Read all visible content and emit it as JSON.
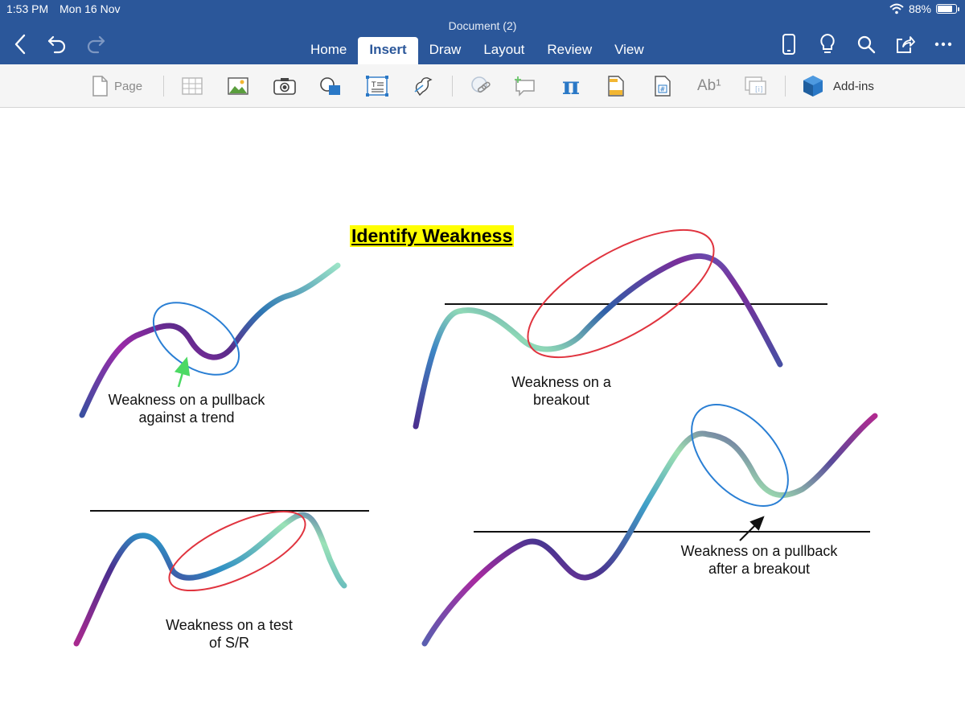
{
  "status_bar": {
    "time": "1:53 PM",
    "date": "Mon 16 Nov",
    "battery": "88%",
    "battery_level": 0.88
  },
  "document_title": "Document (2)",
  "tabs": [
    "Home",
    "Insert",
    "Draw",
    "Layout",
    "Review",
    "View"
  ],
  "active_tab": "Insert",
  "ribbon": {
    "page_label": "Page",
    "addins_label": "Add-ins",
    "pi_symbol": "π",
    "ab_label": "Ab¹"
  },
  "content": {
    "heading": "Identify Weakness",
    "captions": {
      "pullback_trend": [
        "Weakness on a pullback",
        "against a trend"
      ],
      "breakout": [
        "Weakness on a",
        "breakout"
      ],
      "test_sr": [
        "Weakness on a test",
        "of S/R"
      ],
      "pullback_breakout": [
        "Weakness on a pullback",
        "after a breakout"
      ]
    }
  },
  "colors": {
    "chrome": "#2b579a",
    "ellipse_blue": "#2a7fd4",
    "ellipse_red": "#e0343f",
    "highlight": "#ffff00",
    "arrow_green": "#4cd964"
  }
}
